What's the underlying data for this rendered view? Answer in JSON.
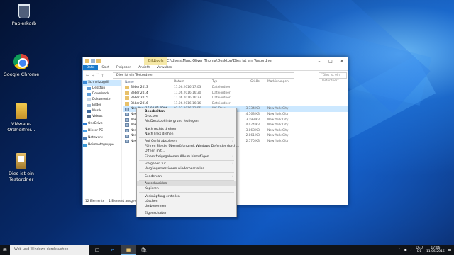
{
  "desktop_icons": [
    {
      "label": "Papierkorb",
      "icon": "recycle-bin-icon"
    },
    {
      "label": "Google Chrome",
      "icon": "chrome-icon"
    },
    {
      "label": "VMware-Ordnerfrei...",
      "icon": "vmware-icon"
    },
    {
      "label": "Dies ist ein Testordner",
      "icon": "folder-shortcut-icon"
    }
  ],
  "explorer": {
    "context_tab": "Bildtools",
    "title": "C:\\Users\\Marc Oliver Thoma\\Desktop\\Dies ist ein Testordner",
    "ribbon_tabs": [
      "Datei",
      "Start",
      "Freigeben",
      "Ansicht",
      "Verwalten"
    ],
    "address": "Dies ist ein Testordner",
    "search_placeholder": "\"Dies ist ein Testordner\" ...",
    "nav_items": [
      {
        "label": "Schnellzugriff",
        "selected": true
      },
      {
        "label": "Desktop"
      },
      {
        "label": "Downloads"
      },
      {
        "label": "Dokumente"
      },
      {
        "label": "Bilder"
      },
      {
        "label": "Musik"
      },
      {
        "label": "Videos"
      },
      {
        "label": "OneDrive"
      },
      {
        "label": "Dieser PC"
      },
      {
        "label": "Netzwerk"
      },
      {
        "label": "Heimnetzgruppe"
      }
    ],
    "columns": [
      "Name",
      "Datum",
      "Typ",
      "Größe",
      "Markierungen"
    ],
    "rows": [
      {
        "name": "Bilder 2013",
        "date": "11.06.2016 17:03",
        "type": "Dateiordner",
        "size": "",
        "tags": "",
        "kind": "folder"
      },
      {
        "name": "Bilder 2014",
        "date": "11.06.2016 16:30",
        "type": "Dateiordner",
        "size": "",
        "tags": "",
        "kind": "folder"
      },
      {
        "name": "Bilder 2015",
        "date": "11.06.2016 16:23",
        "type": "Dateiordner",
        "size": "",
        "tags": "",
        "kind": "folder"
      },
      {
        "name": "Bilder 2016",
        "date": "11.06.2016 16:16",
        "type": "Dateiordner",
        "size": "",
        "tags": "",
        "kind": "folder"
      },
      {
        "name": "New York 16 03 01 0996",
        "date": "01.03.2016 12:55",
        "type": "JPG-Datei",
        "size": "3.734 KB",
        "tags": "New York City",
        "kind": "img",
        "selected": true
      },
      {
        "name": "New...",
        "date": "",
        "type": "",
        "size": "4.563 KB",
        "tags": "New York City",
        "kind": "img"
      },
      {
        "name": "New...",
        "date": "",
        "type": "",
        "size": "3.199 KB",
        "tags": "New York City",
        "kind": "img"
      },
      {
        "name": "New...",
        "date": "",
        "type": "",
        "size": "4.074 KB",
        "tags": "New York City",
        "kind": "img"
      },
      {
        "name": "New...",
        "date": "",
        "type": "",
        "size": "3.868 KB",
        "tags": "New York City",
        "kind": "img"
      },
      {
        "name": "New...",
        "date": "",
        "type": "",
        "size": "2.861 KB",
        "tags": "New York City",
        "kind": "img"
      },
      {
        "name": "New...",
        "date": "",
        "type": "",
        "size": "2.570 KB",
        "tags": "New York City",
        "kind": "img"
      }
    ],
    "status_items": "12 Elemente",
    "status_selected": "1 Element ausgewählt (3,64 MB)"
  },
  "context_menu": [
    {
      "label": "Bearbeiten",
      "bold": true
    },
    {
      "label": "Drucken"
    },
    {
      "label": "Als Desktophintergrund festlegen"
    },
    {
      "sep": true
    },
    {
      "label": "Nach rechts drehen"
    },
    {
      "label": "Nach links drehen"
    },
    {
      "sep": true
    },
    {
      "label": "Auf Gerät abspielen",
      "submenu": true
    },
    {
      "label": "Führen Sie die Überprüfung mit Windows Defender durch..."
    },
    {
      "label": "Öffnen mit..."
    },
    {
      "label": "Einem freigegebenen Album hinzufügen",
      "submenu": true
    },
    {
      "sep": true
    },
    {
      "label": "Freigeben für",
      "submenu": true
    },
    {
      "label": "Vorgängerversionen wiederherstellen"
    },
    {
      "sep": true
    },
    {
      "label": "Senden an",
      "submenu": true
    },
    {
      "sep": true
    },
    {
      "label": "Ausschneiden",
      "hover": true
    },
    {
      "label": "Kopieren"
    },
    {
      "sep": true
    },
    {
      "label": "Verknüpfung erstellen"
    },
    {
      "label": "Löschen"
    },
    {
      "label": "Umbenennen"
    },
    {
      "sep": true
    },
    {
      "label": "Eigenschaften"
    }
  ],
  "taskbar": {
    "search_placeholder": "Web und Windows durchsuchen",
    "lang": "DEU",
    "lang_sub": "DE",
    "time": "17:06",
    "date": "11.06.2016"
  }
}
